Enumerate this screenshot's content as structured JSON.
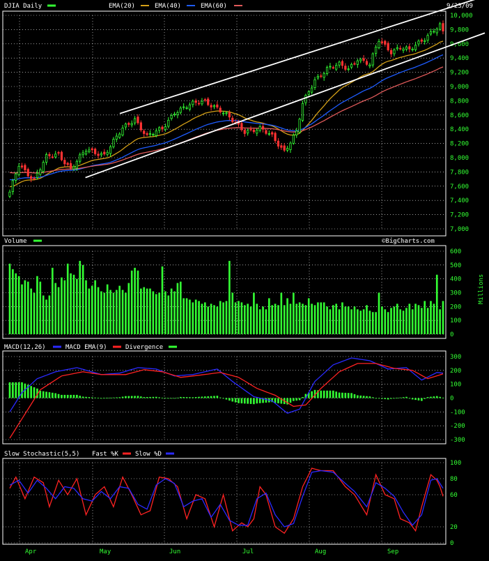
{
  "colors": {
    "bg": "#000000",
    "grid": "#ffffff",
    "text": "#ffffff",
    "axis_text": "#33ff33",
    "up": "#33ff33",
    "down": "#ff3333",
    "ema20": "#d4a017",
    "ema40": "#1e5cff",
    "ema60": "#e05a5a",
    "trend": "#ffffff",
    "volume": "#33ff33",
    "macd": "#2a2aff",
    "macd_signal": "#ff2222",
    "divergence": "#33ff33",
    "fastk": "#ff2222",
    "slowd": "#2a2aff"
  },
  "price_panel": {
    "title": "DJIA Daily",
    "date": "9/23/09",
    "legend": [
      "EMA(20)",
      "EMA(40)",
      "EMA(60)"
    ],
    "y_ticks": [
      "10,000",
      "9,800",
      "9,600",
      "9,400",
      "9,200",
      "9,000",
      "8,800",
      "8,600",
      "8,400",
      "8,200",
      "8,000",
      "7,800",
      "7,600",
      "7,400",
      "7,200",
      "7,000"
    ]
  },
  "volume_panel": {
    "title": "Volume",
    "credit": "©BigCharts.com",
    "y_ticks": [
      "600",
      "500",
      "400",
      "300",
      "200",
      "100",
      "0"
    ],
    "unit_label": "Millions"
  },
  "macd_panel": {
    "title": "MACD(12,26)",
    "legend": [
      "MACD EMA(9)",
      "Divergence"
    ],
    "y_ticks": [
      "300",
      "200",
      "100",
      "0",
      "-100",
      "-200",
      "-300"
    ]
  },
  "stoch_panel": {
    "title": "Slow Stochastic(5,5)",
    "legend": [
      "Fast %K",
      "Slow %D"
    ],
    "y_ticks": [
      "100",
      "80",
      "60",
      "20",
      "0"
    ]
  },
  "x_axis": {
    "months": [
      "Apr",
      "May",
      "Jun",
      "Jul",
      "Aug",
      "Sep"
    ]
  },
  "chart_data": [
    {
      "type": "candlestick",
      "panel": "price",
      "title": "DJIA Daily",
      "ylim": [
        7000,
        10000
      ],
      "x_range": [
        "2009-03-18",
        "2009-09-23"
      ],
      "close_anchors": [
        [
          0,
          7500
        ],
        [
          3,
          7900
        ],
        [
          8,
          7700
        ],
        [
          12,
          8000
        ],
        [
          16,
          8050
        ],
        [
          20,
          7850
        ],
        [
          25,
          8100
        ],
        [
          31,
          8050
        ],
        [
          37,
          8400
        ],
        [
          41,
          8550
        ],
        [
          45,
          8300
        ],
        [
          50,
          8400
        ],
        [
          54,
          8650
        ],
        [
          60,
          8750
        ],
        [
          64,
          8800
        ],
        [
          68,
          8700
        ],
        [
          72,
          8550
        ],
        [
          77,
          8380
        ],
        [
          82,
          8400
        ],
        [
          86,
          8300
        ],
        [
          90,
          8100
        ],
        [
          94,
          8350
        ],
        [
          96,
          8750
        ],
        [
          100,
          9100
        ],
        [
          104,
          9250
        ],
        [
          108,
          9300
        ],
        [
          111,
          9250
        ],
        [
          114,
          9400
        ],
        [
          118,
          9300
        ],
        [
          121,
          9650
        ],
        [
          125,
          9500
        ],
        [
          128,
          9550
        ],
        [
          131,
          9500
        ],
        [
          135,
          9650
        ],
        [
          139,
          9800
        ],
        [
          141,
          9850
        ],
        [
          142,
          9750
        ]
      ],
      "ema_start": {
        "ema20": 7600,
        "ema40": 7700,
        "ema60": 7800
      },
      "trend_lines": [
        {
          "x": [
            "2009-05-05",
            "2009-09-23"
          ],
          "y": [
            8620,
            10080
          ]
        },
        {
          "x": [
            "2009-04-20",
            "2009-09-23"
          ],
          "y": [
            7720,
            9540
          ]
        }
      ]
    },
    {
      "type": "bar",
      "panel": "volume",
      "ylabel": "Millions",
      "ylim": [
        0,
        600
      ],
      "values": [
        510,
        470,
        440,
        420,
        360,
        390,
        380,
        330,
        300,
        420,
        380,
        280,
        250,
        280,
        480,
        370,
        340,
        410,
        390,
        510,
        440,
        430,
        400,
        530,
        500,
        390,
        330,
        350,
        390,
        340,
        310,
        300,
        360,
        320,
        300,
        320,
        350,
        320,
        300,
        370,
        460,
        480,
        460,
        330,
        340,
        330,
        330,
        310,
        290,
        300,
        490,
        310,
        280,
        330,
        310,
        370,
        380,
        260,
        260,
        250,
        230,
        250,
        240,
        220,
        230,
        200,
        220,
        210,
        200,
        240,
        230,
        240,
        530,
        300,
        230,
        240,
        230,
        210,
        220,
        200,
        300,
        220,
        180,
        200,
        180,
        260,
        210,
        220,
        210,
        300,
        210,
        260,
        220,
        300,
        220,
        230,
        220,
        210,
        260,
        220,
        210,
        230,
        230,
        230,
        200,
        180,
        210,
        220,
        180,
        230,
        200,
        200,
        180,
        200,
        180,
        170,
        180,
        210,
        170,
        160,
        160,
        300,
        200,
        180,
        160,
        190,
        200,
        220,
        180,
        170,
        190,
        220,
        180,
        220,
        210,
        190,
        240,
        190,
        240,
        220,
        430,
        180,
        240
      ]
    },
    {
      "type": "line",
      "panel": "macd",
      "ylim": [
        -300,
        300
      ],
      "macd_anchors": [
        [
          0,
          -100
        ],
        [
          4,
          40
        ],
        [
          9,
          140
        ],
        [
          15,
          190
        ],
        [
          22,
          220
        ],
        [
          30,
          170
        ],
        [
          36,
          180
        ],
        [
          42,
          220
        ],
        [
          48,
          210
        ],
        [
          54,
          160
        ],
        [
          60,
          170
        ],
        [
          68,
          210
        ],
        [
          73,
          120
        ],
        [
          80,
          10
        ],
        [
          86,
          -20
        ],
        [
          91,
          -110
        ],
        [
          95,
          -80
        ],
        [
          100,
          120
        ],
        [
          106,
          240
        ],
        [
          112,
          290
        ],
        [
          118,
          270
        ],
        [
          124,
          210
        ],
        [
          130,
          220
        ],
        [
          135,
          130
        ],
        [
          140,
          185
        ],
        [
          142,
          180
        ]
      ],
      "signal_anchors": [
        [
          0,
          -290
        ],
        [
          4,
          -150
        ],
        [
          10,
          60
        ],
        [
          17,
          160
        ],
        [
          24,
          190
        ],
        [
          30,
          170
        ],
        [
          38,
          170
        ],
        [
          44,
          205
        ],
        [
          50,
          190
        ],
        [
          56,
          150
        ],
        [
          62,
          165
        ],
        [
          69,
          185
        ],
        [
          75,
          150
        ],
        [
          81,
          70
        ],
        [
          87,
          20
        ],
        [
          93,
          -60
        ],
        [
          97,
          -50
        ],
        [
          102,
          70
        ],
        [
          108,
          190
        ],
        [
          114,
          250
        ],
        [
          120,
          250
        ],
        [
          126,
          215
        ],
        [
          132,
          200
        ],
        [
          137,
          140
        ],
        [
          142,
          175
        ]
      ]
    },
    {
      "type": "line",
      "panel": "stochastic",
      "ylim": [
        0,
        100
      ],
      "fastk_anchors": [
        [
          0,
          68
        ],
        [
          2,
          82
        ],
        [
          5,
          55
        ],
        [
          8,
          82
        ],
        [
          11,
          75
        ],
        [
          13,
          45
        ],
        [
          16,
          78
        ],
        [
          19,
          60
        ],
        [
          22,
          80
        ],
        [
          25,
          35
        ],
        [
          28,
          60
        ],
        [
          31,
          70
        ],
        [
          34,
          45
        ],
        [
          37,
          82
        ],
        [
          40,
          60
        ],
        [
          43,
          35
        ],
        [
          46,
          40
        ],
        [
          49,
          82
        ],
        [
          52,
          80
        ],
        [
          55,
          70
        ],
        [
          58,
          30
        ],
        [
          61,
          60
        ],
        [
          64,
          55
        ],
        [
          67,
          20
        ],
        [
          70,
          60
        ],
        [
          73,
          15
        ],
        [
          76,
          25
        ],
        [
          78,
          20
        ],
        [
          80,
          30
        ],
        [
          82,
          70
        ],
        [
          84,
          60
        ],
        [
          87,
          20
        ],
        [
          90,
          12
        ],
        [
          93,
          30
        ],
        [
          96,
          70
        ],
        [
          99,
          93
        ],
        [
          102,
          90
        ],
        [
          106,
          90
        ],
        [
          110,
          70
        ],
        [
          113,
          60
        ],
        [
          117,
          35
        ],
        [
          120,
          85
        ],
        [
          123,
          60
        ],
        [
          126,
          55
        ],
        [
          128,
          30
        ],
        [
          131,
          25
        ],
        [
          133,
          15
        ],
        [
          135,
          45
        ],
        [
          138,
          85
        ],
        [
          140,
          78
        ],
        [
          141,
          70
        ],
        [
          142,
          58
        ]
      ],
      "slowd_anchors": [
        [
          0,
          72
        ],
        [
          3,
          78
        ],
        [
          6,
          62
        ],
        [
          9,
          78
        ],
        [
          12,
          68
        ],
        [
          15,
          55
        ],
        [
          18,
          70
        ],
        [
          21,
          68
        ],
        [
          24,
          55
        ],
        [
          27,
          52
        ],
        [
          30,
          64
        ],
        [
          33,
          55
        ],
        [
          36,
          70
        ],
        [
          39,
          68
        ],
        [
          42,
          48
        ],
        [
          45,
          42
        ],
        [
          48,
          72
        ],
        [
          51,
          80
        ],
        [
          54,
          74
        ],
        [
          57,
          45
        ],
        [
          60,
          52
        ],
        [
          63,
          55
        ],
        [
          66,
          32
        ],
        [
          69,
          48
        ],
        [
          72,
          28
        ],
        [
          75,
          22
        ],
        [
          78,
          22
        ],
        [
          81,
          55
        ],
        [
          84,
          62
        ],
        [
          87,
          35
        ],
        [
          90,
          20
        ],
        [
          93,
          24
        ],
        [
          96,
          58
        ],
        [
          99,
          88
        ],
        [
          102,
          90
        ],
        [
          106,
          88
        ],
        [
          110,
          74
        ],
        [
          113,
          64
        ],
        [
          117,
          45
        ],
        [
          120,
          75
        ],
        [
          123,
          68
        ],
        [
          126,
          58
        ],
        [
          129,
          38
        ],
        [
          132,
          22
        ],
        [
          135,
          35
        ],
        [
          138,
          78
        ],
        [
          140,
          80
        ],
        [
          142,
          68
        ]
      ]
    }
  ]
}
